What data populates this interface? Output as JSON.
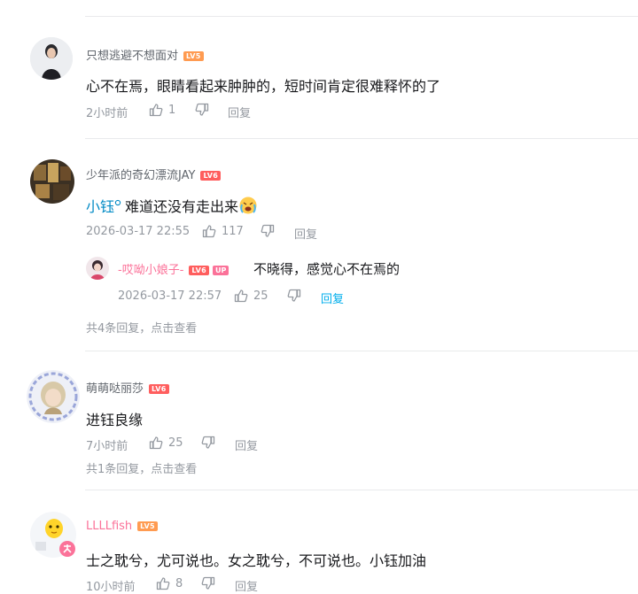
{
  "comments": [
    {
      "username": "只想逃避不想面对",
      "level": "LV5",
      "text": "心不在焉，眼睛看起来肿肿的，短时间肯定很难释怀的了",
      "time": "2小时前",
      "likes": "1",
      "reply_label": "回复"
    },
    {
      "username": "少年派的奇幻漂流JAY",
      "level": "LV6",
      "mention": "小钰",
      "text": "难道还没有走出来",
      "time": "2026-03-17 22:55",
      "likes": "117",
      "reply_label": "回复",
      "sub_reply": {
        "username": "-哎呦小娘子-",
        "level": "LV6",
        "up_badge": "UP",
        "text": "不晓得，感觉心不在焉的",
        "time": "2026-03-17 22:57",
        "likes": "25",
        "reply_label": "回复"
      },
      "more_replies": "共4条回复，点击查看"
    },
    {
      "username": "萌萌哒丽莎",
      "level": "LV6",
      "text": "进钰良缘",
      "time": "7小时前",
      "likes": "25",
      "reply_label": "回复",
      "more_replies": "共1条回复，点击查看"
    },
    {
      "username": "LLLLfish",
      "level": "LV5",
      "text": "士之耽兮，尤可说也。女之耽兮，不可说也。小钰加油",
      "time": "10小时前",
      "likes": "8",
      "reply_label": "回复"
    }
  ],
  "colors": {
    "text": "#18191c",
    "meta": "#9499a0",
    "link_blue": "#00aeec",
    "vip_pink": "#fb7299",
    "lv5": "#ff9b51",
    "lv6": "#ff5e5e"
  },
  "icons": [
    "thumb-up-icon",
    "thumb-down-icon",
    "mention-icon",
    "crying-emoji-icon"
  ]
}
